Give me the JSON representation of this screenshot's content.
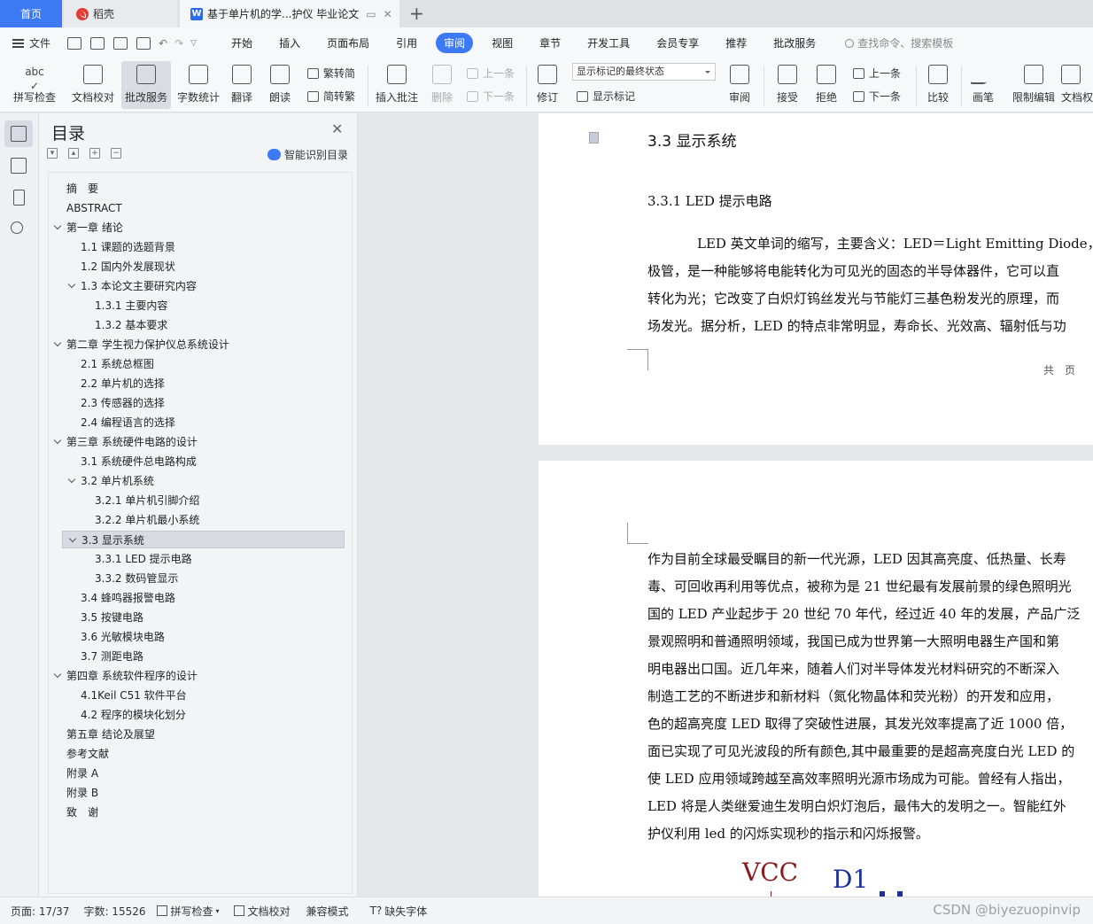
{
  "tabs": {
    "home": "首页",
    "daoke": "稻壳",
    "document": "基于单片机的学...护仪 毕业论文"
  },
  "menu": {
    "file": "文件",
    "tabs": [
      "开始",
      "插入",
      "页面布局",
      "引用",
      "审阅",
      "视图",
      "章节",
      "开发工具",
      "会员专享",
      "推荐",
      "批改服务"
    ],
    "active_tab": "审阅",
    "search_placeholder": "查找命令、搜索模板"
  },
  "ribbon": {
    "spell_check": "拼写检查",
    "doc_proof": "文档校对",
    "correction_service": "批改服务",
    "word_count": "字数统计",
    "translate": "翻译",
    "read_aloud": "朗读",
    "simp_to_trad": "繁转简",
    "trad_to_simp": "简转繁",
    "insert_comment": "插入批注",
    "delete": "删除",
    "prev_comment": "上一条",
    "next_comment": "下一条",
    "revise": "修订",
    "markup_state": "显示标记的最终状态",
    "show_markup": "显示标记",
    "review": "审阅",
    "accept": "接受",
    "reject": "拒绝",
    "prev_change": "上一条",
    "next_change": "下一条",
    "compare": "比较",
    "ink": "画笔",
    "restrict_edit": "限制编辑",
    "doc_rights": "文档权"
  },
  "toc": {
    "title": "目录",
    "smart": "智能识别目录",
    "items": [
      {
        "label": "摘　要",
        "level": 1,
        "chev": false
      },
      {
        "label": "ABSTRACT",
        "level": 1,
        "chev": false
      },
      {
        "label": "第一章  绪论",
        "level": 1,
        "chev": true
      },
      {
        "label": "1.1 课题的选题背景",
        "level": 2,
        "chev": false
      },
      {
        "label": "1.2 国内外发展现状",
        "level": 2,
        "chev": false
      },
      {
        "label": "1.3 本论文主要研究内容",
        "level": 2,
        "chev": true
      },
      {
        "label": "1.3.1 主要内容",
        "level": 3,
        "chev": false
      },
      {
        "label": "1.3.2 基本要求",
        "level": 3,
        "chev": false
      },
      {
        "label": "第二章    学生视力保护仪总系统设计",
        "level": 1,
        "chev": true
      },
      {
        "label": "2.1 系统总框图",
        "level": 2,
        "chev": false
      },
      {
        "label": "2.2 单片机的选择",
        "level": 2,
        "chev": false
      },
      {
        "label": "2.3 传感器的选择",
        "level": 2,
        "chev": false
      },
      {
        "label": "2.4 编程语言的选择",
        "level": 2,
        "chev": false
      },
      {
        "label": "第三章  系统硬件电路的设计",
        "level": 1,
        "chev": true
      },
      {
        "label": "3.1 系统硬件总电路构成",
        "level": 2,
        "chev": false
      },
      {
        "label": "3.2 单片机系统",
        "level": 2,
        "chev": true
      },
      {
        "label": "3.2.1 单片机引脚介绍",
        "level": 3,
        "chev": false
      },
      {
        "label": "3.2.2 单片机最小系统",
        "level": 3,
        "chev": false
      },
      {
        "label": "3.3 显示系统",
        "level": 2,
        "chev": true,
        "selected": true
      },
      {
        "label": "3.3.1 LED 提示电路",
        "level": 3,
        "chev": false
      },
      {
        "label": "3.3.2 数码管显示",
        "level": 3,
        "chev": false
      },
      {
        "label": "3.4 蜂鸣器报警电路",
        "level": 2,
        "chev": false
      },
      {
        "label": "3.5 按键电路",
        "level": 2,
        "chev": false
      },
      {
        "label": "3.6 光敏模块电路",
        "level": 2,
        "chev": false
      },
      {
        "label": "3.7 测距电路",
        "level": 2,
        "chev": false
      },
      {
        "label": "第四章  系统软件程序的设计",
        "level": 1,
        "chev": true
      },
      {
        "label": "4.1Keil C51 软件平台",
        "level": 2,
        "chev": false
      },
      {
        "label": "4.2 程序的模块化划分",
        "level": 2,
        "chev": false
      },
      {
        "label": "第五章     结论及展望",
        "level": 1,
        "chev": false
      },
      {
        "label": "参考文献",
        "level": 1,
        "chev": false
      },
      {
        "label": "附录  A",
        "level": 1,
        "chev": false
      },
      {
        "label": "附录  B",
        "level": 1,
        "chev": false
      },
      {
        "label": "致　谢",
        "level": 1,
        "chev": false
      }
    ]
  },
  "doc": {
    "heading": "3.3 显示系统",
    "subheading": "3.3.1 LED 提示电路",
    "page1_lines": [
      "LED 英文单词的缩写，主要含义：LED＝Light Emitting Diode，",
      "极管，是一种能够将电能转化为可见光的固态的半导体器件，它可以直",
      "转化为光；它改变了白炽灯钨丝发光与节能灯三基色粉发光的原理，而",
      "场发光。据分析，LED 的特点非常明显，寿命长、光效高、辐射低与功"
    ],
    "footer": "共　页",
    "page2_lines": [
      "作为目前全球最受瞩目的新一代光源，LED 因其高亮度、低热量、长寿",
      "毒、可回收再利用等优点，被称为是 21 世纪最有发展前景的绿色照明光",
      "国的 LED 产业起步于 20 世纪 70 年代，经过近 40 年的发展，产品广泛",
      "景观照明和普通照明领域，我国已成为世界第一大照明电器生产国和第",
      "明电器出口国。近几年来，随着人们对半导体发光材料研究的不断深入",
      "制造工艺的不断进步和新材料（氮化物晶体和荧光粉）的开发和应用，",
      "色的超高亮度 LED 取得了突破性进展，其发光效率提高了近 1000 倍，",
      "面已实现了可见光波段的所有颜色,其中最重要的是超高亮度白光 LED 的",
      "使 LED 应用领域跨越至高效率照明光源市场成为可能。曾经有人指出，",
      "LED 将是人类继爱迪生发明白炽灯泡后，最伟大的发明之一。智能红外",
      "护仪利用 led 的闪烁实现秒的指示和闪烁报警。"
    ],
    "circuit_vcc": "VCC",
    "circuit_d1": "D1"
  },
  "status": {
    "page": "页面: 17/37",
    "words": "字数: 15526",
    "spell": "拼写检查",
    "proof": "文档校对",
    "compat": "兼容模式",
    "missing_font": "缺失字体"
  },
  "watermark": "CSDN @biyezuopinvip",
  "colors": {
    "accent": "#3c7af5",
    "circuit_red": "#8b1a1a",
    "circuit_blue": "#1c2fa0"
  }
}
